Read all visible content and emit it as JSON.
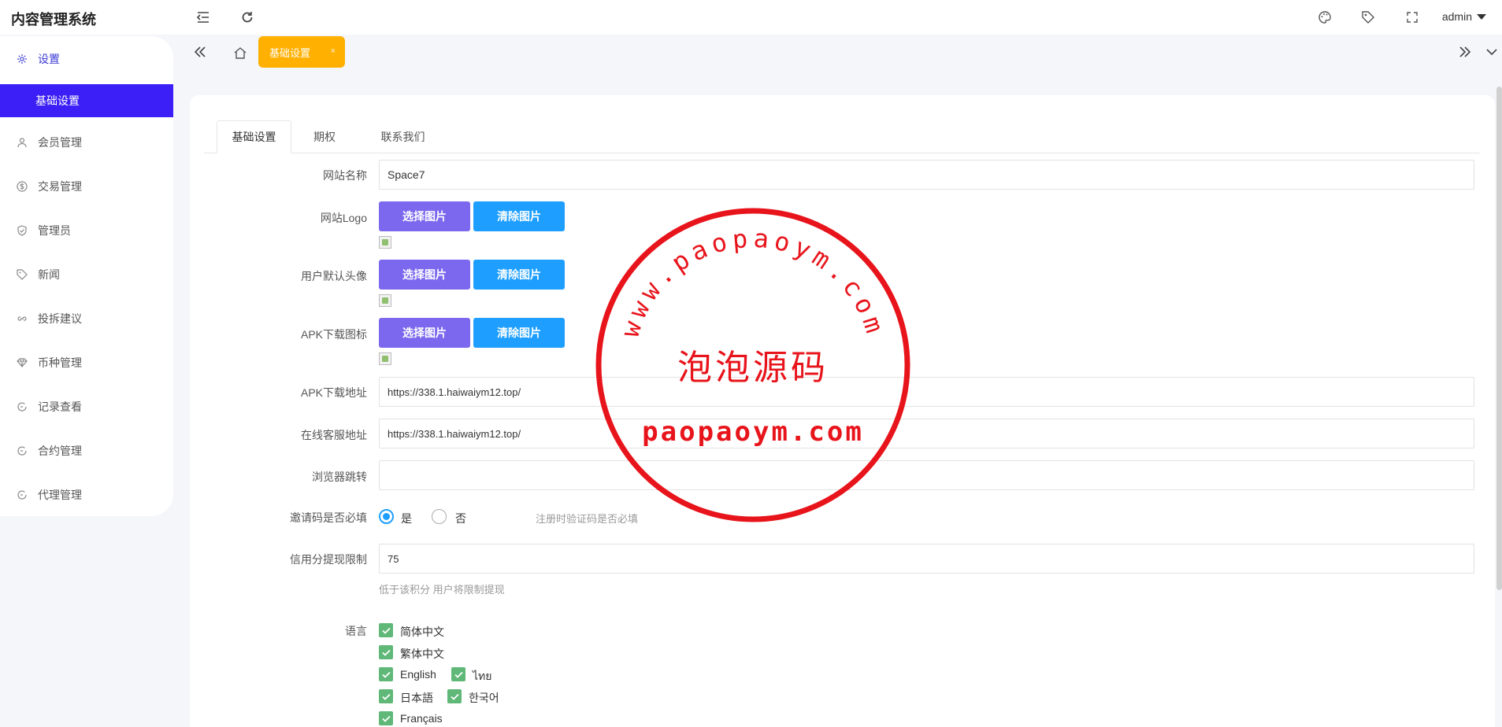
{
  "app": {
    "title": "内容管理系统",
    "user": "admin"
  },
  "sidebar": {
    "items": [
      {
        "label": "设置",
        "icon": "gear-icon"
      },
      {
        "label": "基础设置",
        "icon": ""
      },
      {
        "label": "会员管理",
        "icon": "user-icon"
      },
      {
        "label": "交易管理",
        "icon": "dollar-icon"
      },
      {
        "label": "管理员",
        "icon": "shield-icon"
      },
      {
        "label": "新闻",
        "icon": "tag-icon"
      },
      {
        "label": "投拆建议",
        "icon": "link-icon"
      },
      {
        "label": "币种管理",
        "icon": "diamond-icon"
      },
      {
        "label": "记录查看",
        "icon": "circle-arrow-icon"
      },
      {
        "label": "合约管理",
        "icon": "circle-arrow-icon"
      },
      {
        "label": "代理管理",
        "icon": "circle-arrow-icon"
      }
    ]
  },
  "pagetabs": {
    "active_label": "基础设置",
    "close": "×"
  },
  "form_tabs": [
    "基础设置",
    "期权",
    "联系我们"
  ],
  "form": {
    "site_name_label": "网站名称",
    "site_name_value": "Space7",
    "logo_label": "网站Logo",
    "avatar_label": "用户默认头像",
    "apk_icon_label": "APK下载图标",
    "select_image": "选择图片",
    "clear_image": "清除图片",
    "apk_url_label": "APK下载地址",
    "apk_url_value": "https://338.1.haiwaiym12.top/",
    "service_url_label": "在线客服地址",
    "service_url_value": "https://338.1.haiwaiym12.top/",
    "browser_redirect_label": "浏览器跳转",
    "browser_redirect_value": "",
    "invite_label": "邀请码是否必填",
    "invite_yes": "是",
    "invite_no": "否",
    "invite_hint": "注册时验证码是否必填",
    "credit_label": "信用分提现限制",
    "credit_value": "75",
    "credit_hint": "低于该积分 用户将限制提现",
    "language_label": "语言",
    "languages": [
      "简体中文",
      "繁体中文",
      "English",
      "ไทย",
      "日本語",
      "한국어",
      "Français"
    ]
  },
  "watermark": {
    "url_top": "www.paopaoym.com",
    "center_text": "泡泡源码",
    "bottom_text": "paopaoym.com",
    "color": "#e8141b"
  }
}
